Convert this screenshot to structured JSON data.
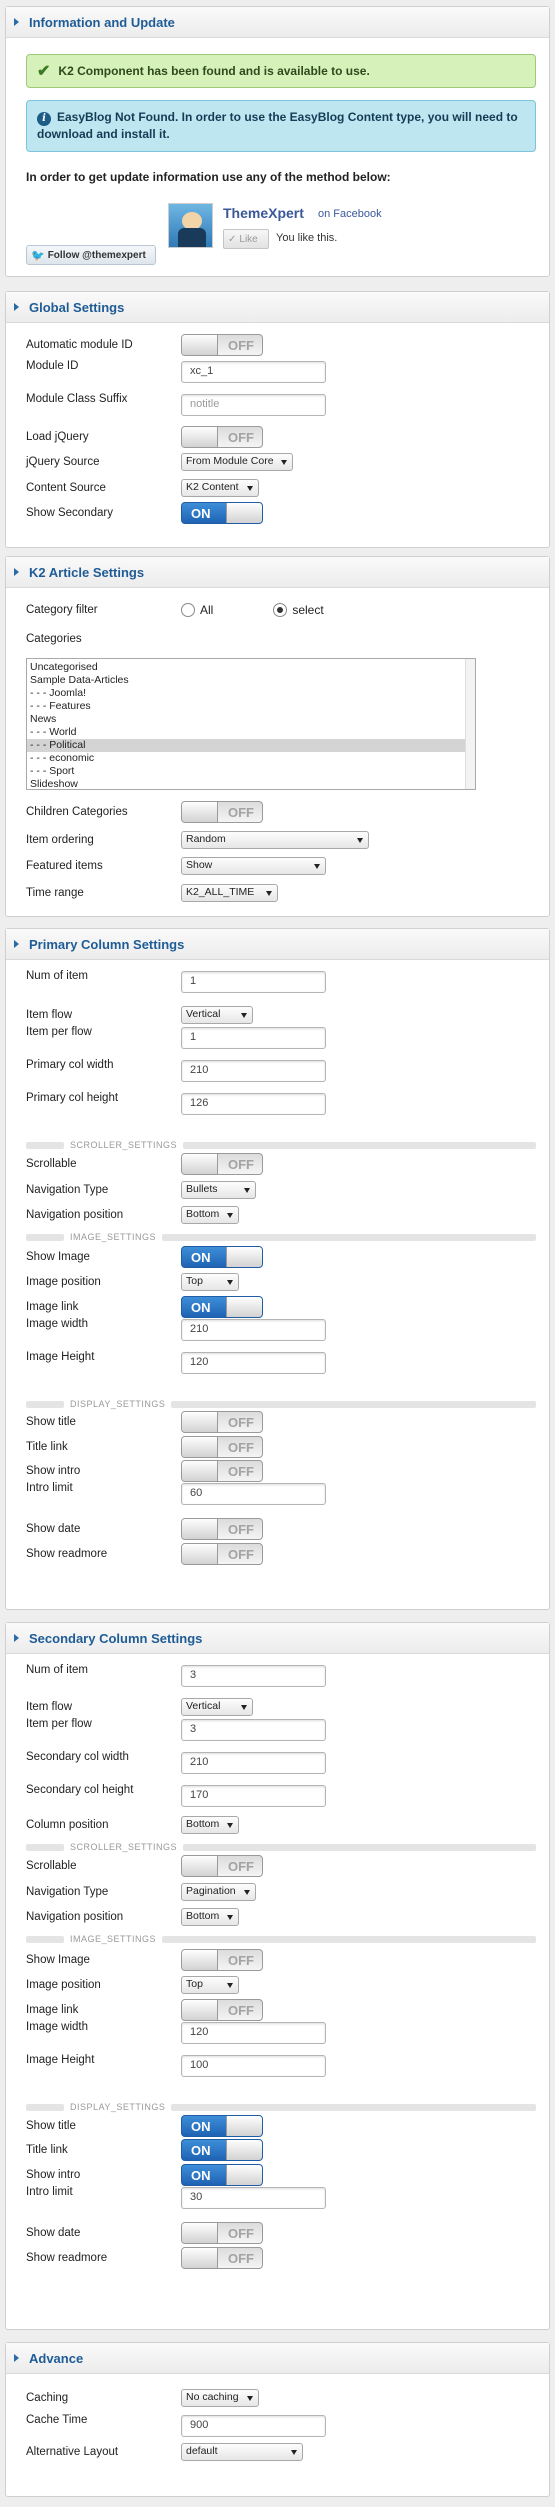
{
  "info": {
    "title": "Information and Update",
    "k2_alert": "K2 Component has been found and is available to use.",
    "easyblog_alert_line1": "EasyBlog Not Found. In order to use the EasyBlog Content type, you will need to",
    "easyblog_alert_line2": "download and install it.",
    "update_text": "In order to get update information use any of the method below:",
    "fb_name": "ThemeXpert",
    "fb_on": "on Facebook",
    "fb_like": "Like",
    "fb_like_text": "You like this.",
    "twitter_follow": "Follow @themexpert"
  },
  "global": {
    "title": "Global Settings",
    "auto_module_id": {
      "label": "Automatic module ID",
      "value": "OFF"
    },
    "module_id": {
      "label": "Module ID",
      "value": "xc_1"
    },
    "module_class_suffix": {
      "label": "Module Class Suffix",
      "placeholder": "notitle"
    },
    "load_jquery": {
      "label": "Load jQuery",
      "value": "OFF"
    },
    "jquery_source": {
      "label": "jQuery Source",
      "value": "From Module Core"
    },
    "content_source": {
      "label": "Content Source",
      "value": "K2 Content"
    },
    "show_secondary": {
      "label": "Show Secondary",
      "value": "ON"
    }
  },
  "k2": {
    "title": "K2 Article Settings",
    "category_filter": {
      "label": "Category filter",
      "options": [
        "All",
        "select"
      ],
      "selected": "select"
    },
    "categories_label": "Categories",
    "categories": [
      "Uncategorised",
      "Sample Data-Articles",
      "- - - Joomla!",
      "- - - Features",
      "News",
      "- - - World",
      "- - - Political",
      "- - - economic",
      "- - - Sport",
      "Slideshow"
    ],
    "selected_category": "- - - Political",
    "children_categories": {
      "label": "Children Categories",
      "value": "OFF"
    },
    "item_ordering": {
      "label": "Item ordering",
      "value": "Random"
    },
    "featured_items": {
      "label": "Featured items",
      "value": "Show"
    },
    "time_range": {
      "label": "Time range",
      "value": "K2_ALL_TIME"
    }
  },
  "primary": {
    "title": "Primary Column Settings",
    "num_of_item": {
      "label": "Num of item",
      "value": "1"
    },
    "item_flow": {
      "label": "Item flow",
      "value": "Vertical"
    },
    "item_per_flow": {
      "label": "Item per flow",
      "value": "1"
    },
    "col_width": {
      "label": "Primary col width",
      "value": "210"
    },
    "col_height": {
      "label": "Primary col height",
      "value": "126"
    },
    "scroller_settings": "SCROLLER_SETTINGS",
    "scrollable": {
      "label": "Scrollable",
      "value": "OFF"
    },
    "navigation_type": {
      "label": "Navigation Type",
      "value": "Bullets"
    },
    "navigation_position": {
      "label": "Navigation position",
      "value": "Bottom"
    },
    "image_settings": "IMAGE_SETTINGS",
    "show_image": {
      "label": "Show Image",
      "value": "ON"
    },
    "image_position": {
      "label": "Image position",
      "value": "Top"
    },
    "image_link": {
      "label": "Image link",
      "value": "ON"
    },
    "image_width": {
      "label": "Image width",
      "value": "210"
    },
    "image_height": {
      "label": "Image Height",
      "value": "120"
    },
    "display_settings": "DISPLAY_SETTINGS",
    "show_title": {
      "label": "Show title",
      "value": "OFF"
    },
    "title_link": {
      "label": "Title link",
      "value": "OFF"
    },
    "show_intro": {
      "label": "Show intro",
      "value": "OFF"
    },
    "intro_limit": {
      "label": "Intro limit",
      "value": "60"
    },
    "show_date": {
      "label": "Show date",
      "value": "OFF"
    },
    "show_readmore": {
      "label": "Show readmore",
      "value": "OFF"
    }
  },
  "secondary": {
    "title": "Secondary Column Settings",
    "num_of_item": {
      "label": "Num of item",
      "value": "3"
    },
    "item_flow": {
      "label": "Item flow",
      "value": "Vertical"
    },
    "item_per_flow": {
      "label": "Item per flow",
      "value": "3"
    },
    "col_width": {
      "label": "Secondary col width",
      "value": "210"
    },
    "col_height": {
      "label": "Secondary col height",
      "value": "170"
    },
    "column_position": {
      "label": "Column position",
      "value": "Bottom"
    },
    "scroller_settings": "SCROLLER_SETTINGS",
    "scrollable": {
      "label": "Scrollable",
      "value": "OFF"
    },
    "navigation_type": {
      "label": "Navigation Type",
      "value": "Pagination"
    },
    "navigation_position": {
      "label": "Navigation position",
      "value": "Bottom"
    },
    "image_settings": "IMAGE_SETTINGS",
    "show_image": {
      "label": "Show Image",
      "value": "OFF"
    },
    "image_position": {
      "label": "Image position",
      "value": "Top"
    },
    "image_link": {
      "label": "Image link",
      "value": "OFF"
    },
    "image_width": {
      "label": "Image width",
      "value": "120"
    },
    "image_height": {
      "label": "Image Height",
      "value": "100"
    },
    "display_settings": "DISPLAY_SETTINGS",
    "show_title": {
      "label": "Show title",
      "value": "ON"
    },
    "title_link": {
      "label": "Title link",
      "value": "ON"
    },
    "show_intro": {
      "label": "Show intro",
      "value": "ON"
    },
    "intro_limit": {
      "label": "Intro limit",
      "value": "30"
    },
    "show_date": {
      "label": "Show date",
      "value": "OFF"
    },
    "show_readmore": {
      "label": "Show readmore",
      "value": "OFF"
    }
  },
  "advance": {
    "title": "Advance",
    "caching": {
      "label": "Caching",
      "value": "No caching"
    },
    "cache_time": {
      "label": "Cache Time",
      "value": "900"
    },
    "alternative_layout": {
      "label": "Alternative Layout",
      "value": "default"
    }
  },
  "colors": {
    "accent": "#1f5c96",
    "toggle_on": "#2a76c8",
    "success_bg": "#d6f0b8",
    "info_bg": "#b9e4f0"
  }
}
